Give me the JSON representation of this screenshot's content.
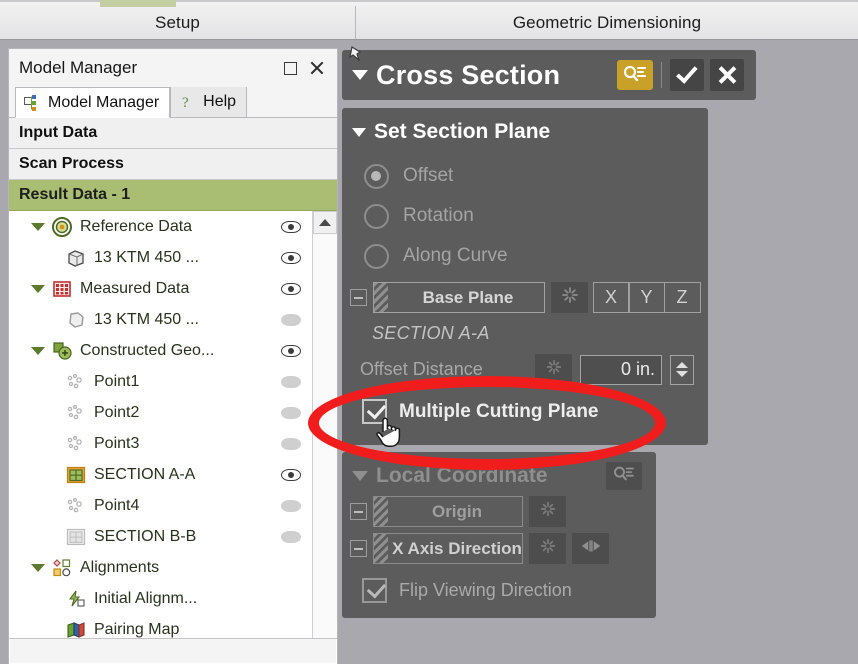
{
  "ribbon": {
    "tabs": [
      {
        "label": "Setup",
        "active": false
      },
      {
        "label": "Geometric Dimensioning",
        "active": true
      }
    ]
  },
  "model_manager": {
    "title": "Model Manager",
    "window_buttons": {
      "maximize": "maximize-icon",
      "close": "close-icon"
    },
    "tabs": [
      {
        "label": "Model Manager",
        "icon": "model-tree-icon",
        "active": true
      },
      {
        "label": "Help",
        "icon": "help-icon",
        "active": false
      }
    ],
    "sections": [
      {
        "label": "Input Data",
        "highlight": false
      },
      {
        "label": "Scan Process",
        "highlight": false
      },
      {
        "label": "Result Data - 1",
        "highlight": true
      }
    ],
    "tree": [
      {
        "label": "Reference Data",
        "level": 0,
        "caret": true,
        "icon": "target-icon",
        "visibility": "visible"
      },
      {
        "label": "13 KTM 450 ...",
        "level": 1,
        "caret": false,
        "icon": "cube-icon",
        "visibility": "visible"
      },
      {
        "label": "Measured Data",
        "level": 0,
        "caret": true,
        "icon": "grid-red-icon",
        "visibility": "visible"
      },
      {
        "label": "13 KTM 450 ...",
        "level": 1,
        "caret": false,
        "icon": "mesh-icon",
        "visibility": "hidden"
      },
      {
        "label": "Constructed Geo...",
        "level": 0,
        "caret": true,
        "icon": "constructed-geometry-icon",
        "visibility": "visible"
      },
      {
        "label": "Point1",
        "level": 1,
        "caret": false,
        "icon": "point-cloud-icon",
        "visibility": "hidden"
      },
      {
        "label": "Point2",
        "level": 1,
        "caret": false,
        "icon": "point-cloud-icon",
        "visibility": "hidden"
      },
      {
        "label": "Point3",
        "level": 1,
        "caret": false,
        "icon": "point-cloud-icon",
        "visibility": "hidden"
      },
      {
        "label": "SECTION A-A",
        "level": 1,
        "caret": false,
        "icon": "section-active-icon",
        "visibility": "visible"
      },
      {
        "label": "Point4",
        "level": 1,
        "caret": false,
        "icon": "point-cloud-icon",
        "visibility": "hidden"
      },
      {
        "label": "SECTION B-B",
        "level": 1,
        "caret": false,
        "icon": "section-inactive-icon",
        "visibility": "hidden"
      },
      {
        "label": "Alignments",
        "level": 0,
        "caret": true,
        "icon": "alignments-icon",
        "visibility": "none"
      },
      {
        "label": "Initial Alignm...",
        "level": 1,
        "caret": false,
        "icon": "initial-alignment-icon",
        "visibility": "none"
      },
      {
        "label": "Pairing Map",
        "level": 1,
        "caret": false,
        "icon": "pairing-map-icon",
        "visibility": "none"
      }
    ],
    "scrollbar": {
      "up_arrow": "scroll-up-icon"
    }
  },
  "cross_section": {
    "title": "Cross Section",
    "pin_icon": "pin-icon",
    "collapse_caret": "caret-down-icon",
    "actions": [
      {
        "name": "query-button",
        "icon": "magnifier-list-icon",
        "color": "#c9a128"
      },
      {
        "name": "confirm-button",
        "icon": "check-icon",
        "color": "#454545"
      },
      {
        "name": "cancel-button",
        "icon": "close-icon",
        "color": "#454545"
      }
    ],
    "set_section_plane": {
      "group_title": "Set Section Plane",
      "radios": [
        {
          "label": "Offset",
          "selected": true
        },
        {
          "label": "Rotation",
          "selected": false
        },
        {
          "label": "Along Curve",
          "selected": false
        }
      ],
      "base_plane": {
        "label": "Base Plane",
        "pick_icon": "pick-hatch-icon",
        "reset_icon": "snap-icon",
        "axes": [
          "X",
          "Y",
          "Z"
        ]
      },
      "section_name": "SECTION A-A",
      "offset_distance": {
        "label": "Offset Distance",
        "value": "0 in.",
        "spinner": "stepper-icon"
      },
      "multiple_cutting_plane": {
        "label": "Multiple Cutting Plane",
        "checked": true
      }
    },
    "local_coordinate": {
      "group_title": "Local Coordinate",
      "query_icon": "magnifier-list-icon",
      "origin": {
        "label": "Origin",
        "reset_icon": "snap-icon"
      },
      "x_axis_direction": {
        "label": "X Axis Direction",
        "reset_icon": "snap-icon",
        "flip_icon": "flip-arrows-icon"
      },
      "flip_viewing_direction": {
        "label": "Flip Viewing Direction",
        "checked": true
      }
    }
  },
  "annotation": {
    "highlight_shape": "red-ellipse",
    "highlight_color": "#f11d1d",
    "cursor": "hand-pointer-cursor"
  },
  "colors": {
    "panel_dark": "#5c5c5c",
    "accent_green": "#a9bd73",
    "accent_gold": "#c9a128",
    "annotation_red": "#f11d1d",
    "canvas_bg": "#a9a8ae"
  }
}
